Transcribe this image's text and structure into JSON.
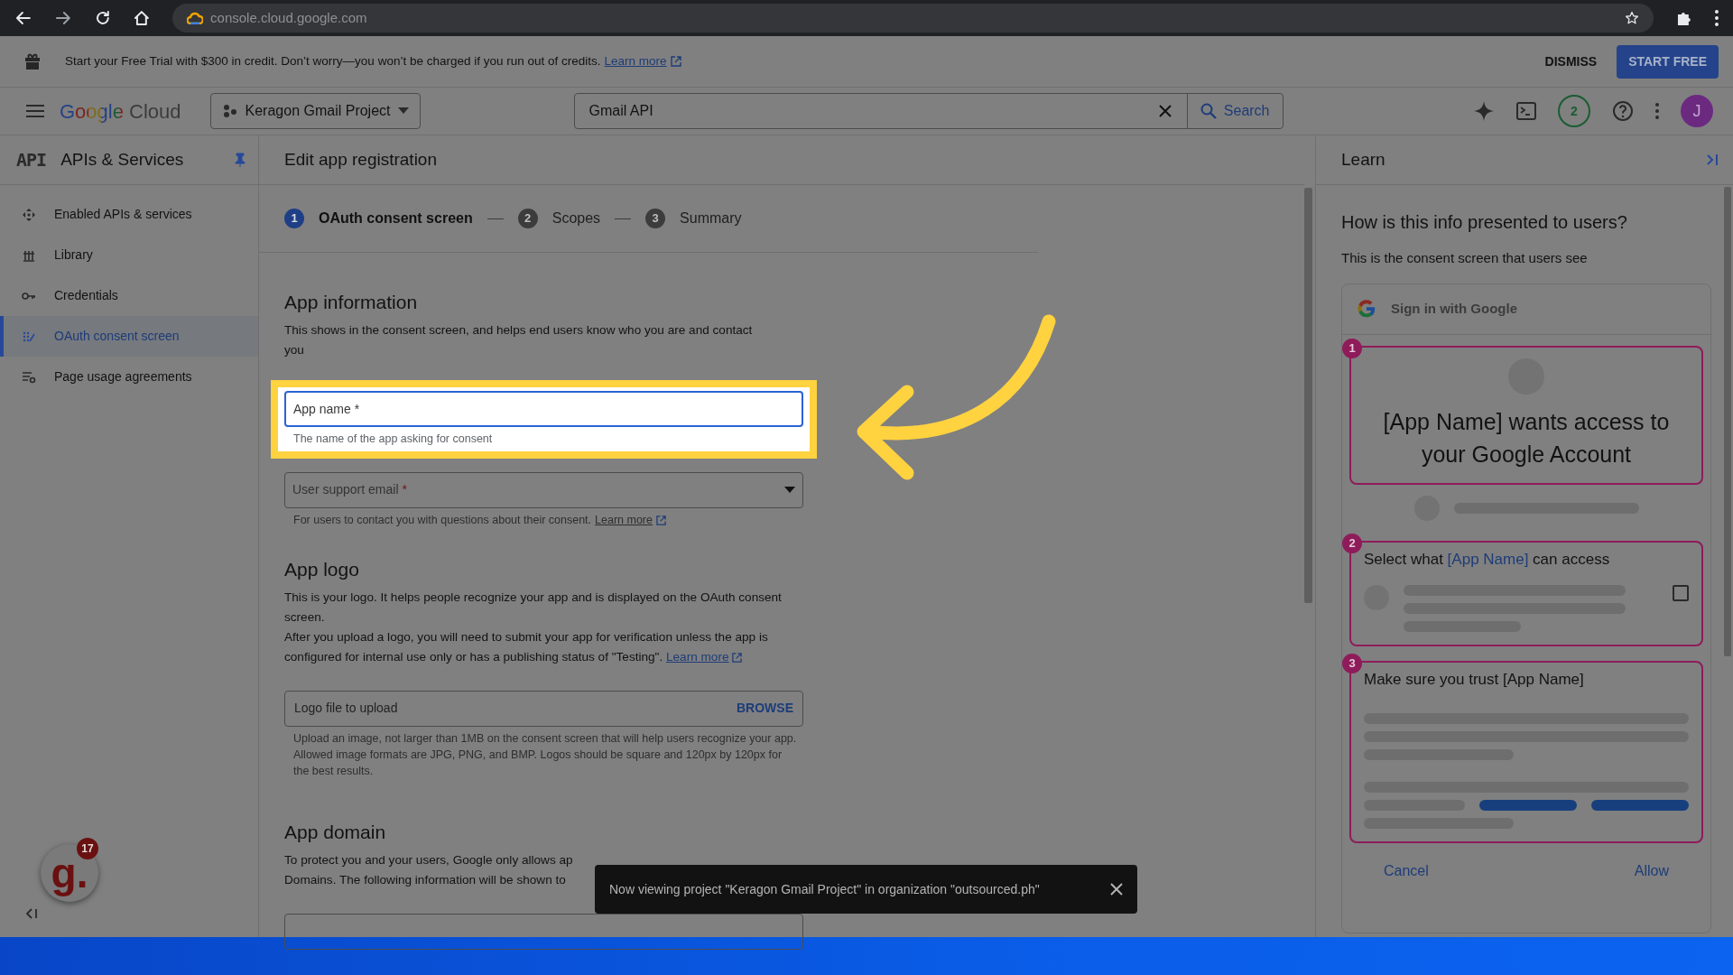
{
  "browser": {
    "url": "console.cloud.google.com"
  },
  "banner": {
    "text": "Start your Free Trial with $300 in credit. Don’t worry—you won’t be charged if you run out of credits.",
    "link": "Learn more",
    "dismiss": "DISMISS",
    "start": "START FREE"
  },
  "header": {
    "logo": "Google Cloud",
    "project": "Keragon Gmail Project",
    "search_value": "Gmail API",
    "search_button": "Search",
    "notifications": "2",
    "avatar": "J"
  },
  "sidebar": {
    "badge": "API",
    "title": "APIs & Services",
    "items": [
      {
        "label": "Enabled APIs & services",
        "selected": false
      },
      {
        "label": "Library",
        "selected": false
      },
      {
        "label": "Credentials",
        "selected": false
      },
      {
        "label": "OAuth consent screen",
        "selected": true
      },
      {
        "label": "Page usage agreements",
        "selected": false
      }
    ]
  },
  "page": {
    "title": "Edit app registration",
    "steps": [
      {
        "number": "1",
        "label": "OAuth consent screen",
        "selected": true
      },
      {
        "number": "2",
        "label": "Scopes",
        "selected": false
      },
      {
        "number": "3",
        "label": "Summary",
        "selected": false
      }
    ]
  },
  "app_information": {
    "heading": "App information",
    "description": "This shows in the consent screen, and helps end users know who you are and contact you",
    "app_name": {
      "placeholder": "App name *",
      "helper": "The name of the app asking for consent",
      "highlighted": true
    },
    "support_email": {
      "placeholder": "User support email",
      "required_mark": "*",
      "helper": "For users to contact you with questions about their consent.",
      "link": "Learn more"
    }
  },
  "app_logo": {
    "heading": "App logo",
    "paragraphs": [
      "This is your logo. It helps people recognize your app and is displayed on the OAuth consent screen.",
      "After you upload a logo, you will need to submit your app for verification unless the app is configured for internal use only or has a publishing status of \"Testing\"."
    ],
    "link": "Learn more",
    "upload": {
      "placeholder": "Logo file to upload",
      "button": "BROWSE",
      "helper": "Upload an image, not larger than 1MB on the consent screen that will help users recognize your app. Allowed image formats are JPG, PNG, and BMP. Logos should be square and 120px by 120px for the best results."
    }
  },
  "app_domain": {
    "heading": "App domain",
    "lines": [
      "To protect you and your users, Google only allows ap",
      "Domains. The following information will be shown to"
    ]
  },
  "toast": {
    "message": "Now viewing project \"Keragon Gmail Project\" in organization \"outsourced.ph\""
  },
  "widget": {
    "logo": "g.",
    "count": "17"
  },
  "learn": {
    "title": "Learn",
    "heading": "How is this info presented to users?",
    "subtitle": "This is the consent screen that users see",
    "preview": {
      "signin": "Sign in with Google",
      "callouts": [
        {
          "kind": "title",
          "number": "1",
          "text": "[App Name] wants access to your Google Account"
        },
        {
          "kind": "scope",
          "number": "2",
          "parts": [
            "Select what ",
            "[App Name]",
            " can access"
          ],
          "checked": false
        },
        {
          "kind": "trust",
          "number": "3",
          "text": "Make sure you trust [App Name]"
        }
      ],
      "cancel": "Cancel",
      "allow": "Allow"
    }
  }
}
